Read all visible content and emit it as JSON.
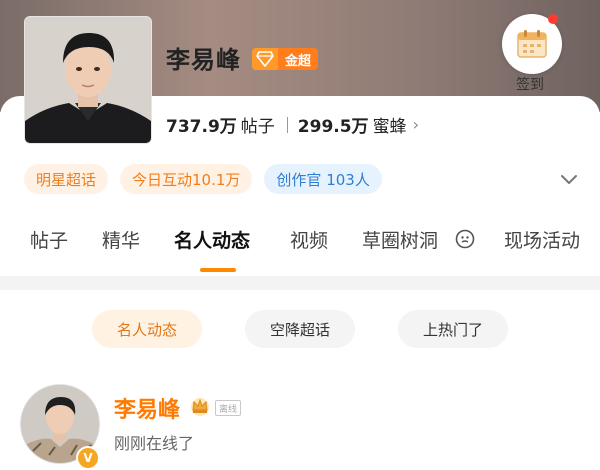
{
  "profile": {
    "name": "李易峰",
    "level_badge": "金超",
    "checkin_label": "签到",
    "posts_count": "737.9万",
    "posts_unit": "帖子",
    "fans_count": "299.5万",
    "fans_unit": "蜜蜂",
    "chevron": "›"
  },
  "pills": [
    {
      "label": "明星超话",
      "style": "orange"
    },
    {
      "label": "今日互动10.1万",
      "style": "orange"
    },
    {
      "label": "创作官 103人",
      "style": "blue"
    }
  ],
  "tabs": {
    "items": [
      "帖子",
      "精华",
      "名人动态",
      "视频",
      "草圈树洞",
      "现场活动"
    ],
    "active": "名人动态"
  },
  "chips": {
    "items": [
      "名人动态",
      "空降超话",
      "上热门了"
    ],
    "active": "名人动态"
  },
  "post": {
    "author": "李易峰",
    "offline_tag": "离线",
    "status": "刚刚在线了",
    "verify_badge": "V"
  },
  "colors": {
    "accent": "#ff8a00",
    "pill_orange_text": "#f07d1c",
    "pill_blue_text": "#2e7fd3"
  }
}
